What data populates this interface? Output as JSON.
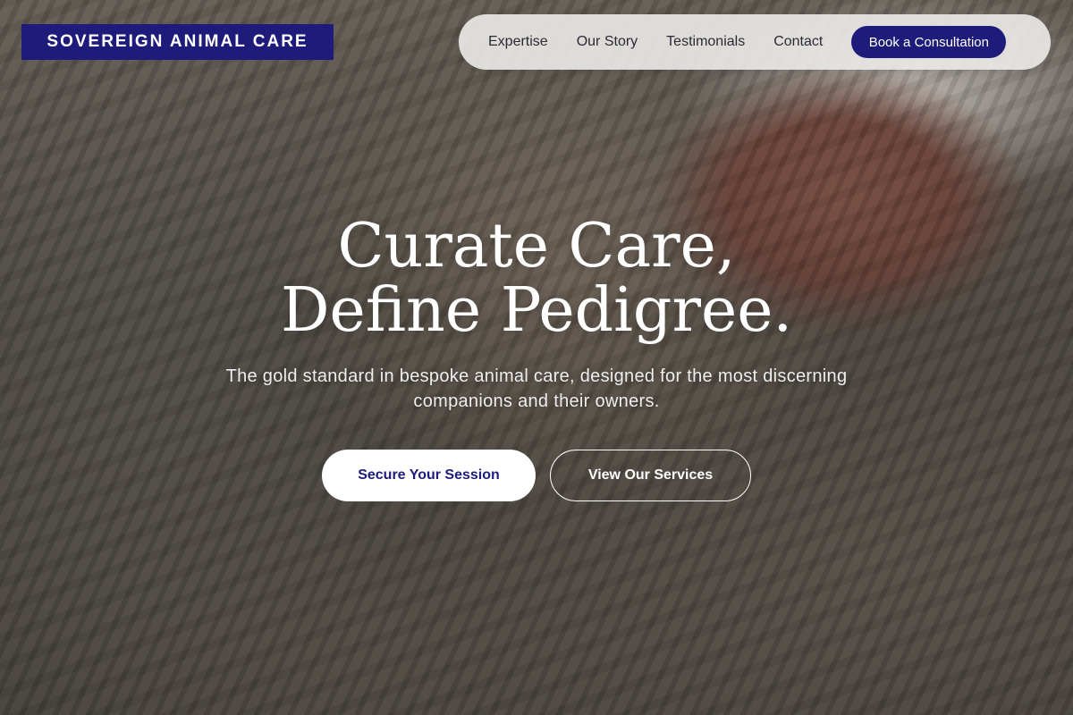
{
  "brand": {
    "name": "SOVEREIGN ANIMAL CARE",
    "color": "#1e1b7a"
  },
  "nav": {
    "links": [
      "Expertise",
      "Our Story",
      "Testimonials",
      "Contact"
    ],
    "cta_label": "Book a Consultation"
  },
  "hero": {
    "title_line1": "Curate Care,",
    "title_line2": "Define Pedigree.",
    "subtitle": "The gold standard in bespoke animal care, designed for the most discerning companions and their owners.",
    "primary_button": "Secure Your Session",
    "secondary_button": "View Our Services"
  }
}
